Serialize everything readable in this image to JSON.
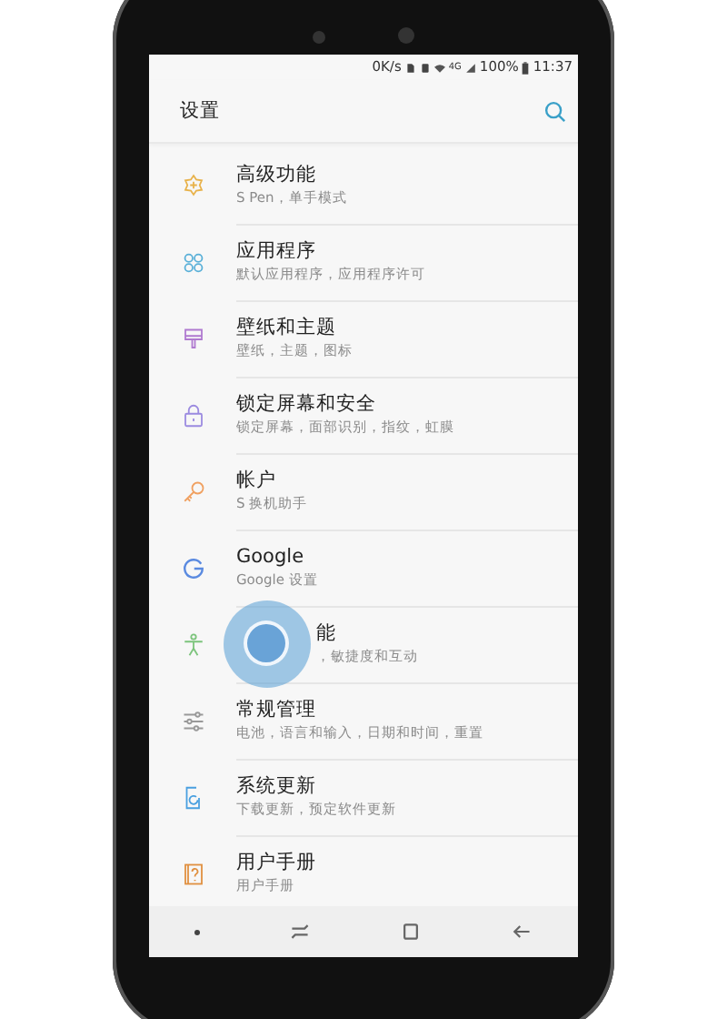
{
  "status_bar": {
    "speed": "0K/s",
    "network": "4G",
    "battery": "100%",
    "time": "11:37"
  },
  "header": {
    "title": "设置"
  },
  "items": [
    {
      "kind": "advanced",
      "title": "高级功能",
      "subtitle": "S Pen，单手模式"
    },
    {
      "kind": "apps",
      "title": "应用程序",
      "subtitle": "默认应用程序，应用程序许可"
    },
    {
      "kind": "wallpaper",
      "title": "壁纸和主题",
      "subtitle": "壁纸，主题，图标"
    },
    {
      "kind": "lock",
      "title": "锁定屏幕和安全",
      "subtitle": "锁定屏幕，面部识别，指纹，虹膜"
    },
    {
      "kind": "account",
      "title": "帐户",
      "subtitle": "S 换机助手"
    },
    {
      "kind": "google",
      "title": "Google",
      "subtitle": "Google 设置"
    },
    {
      "kind": "accessibility",
      "title": "能",
      "subtitle": "，敏捷度和互动",
      "touched": true
    },
    {
      "kind": "general",
      "title": "常规管理",
      "subtitle": "电池，语言和输入，日期和时间，重置"
    },
    {
      "kind": "update",
      "title": "系统更新",
      "subtitle": "下载更新，预定软件更新"
    },
    {
      "kind": "manual",
      "title": "用户手册",
      "subtitle": "用户手册"
    }
  ]
}
